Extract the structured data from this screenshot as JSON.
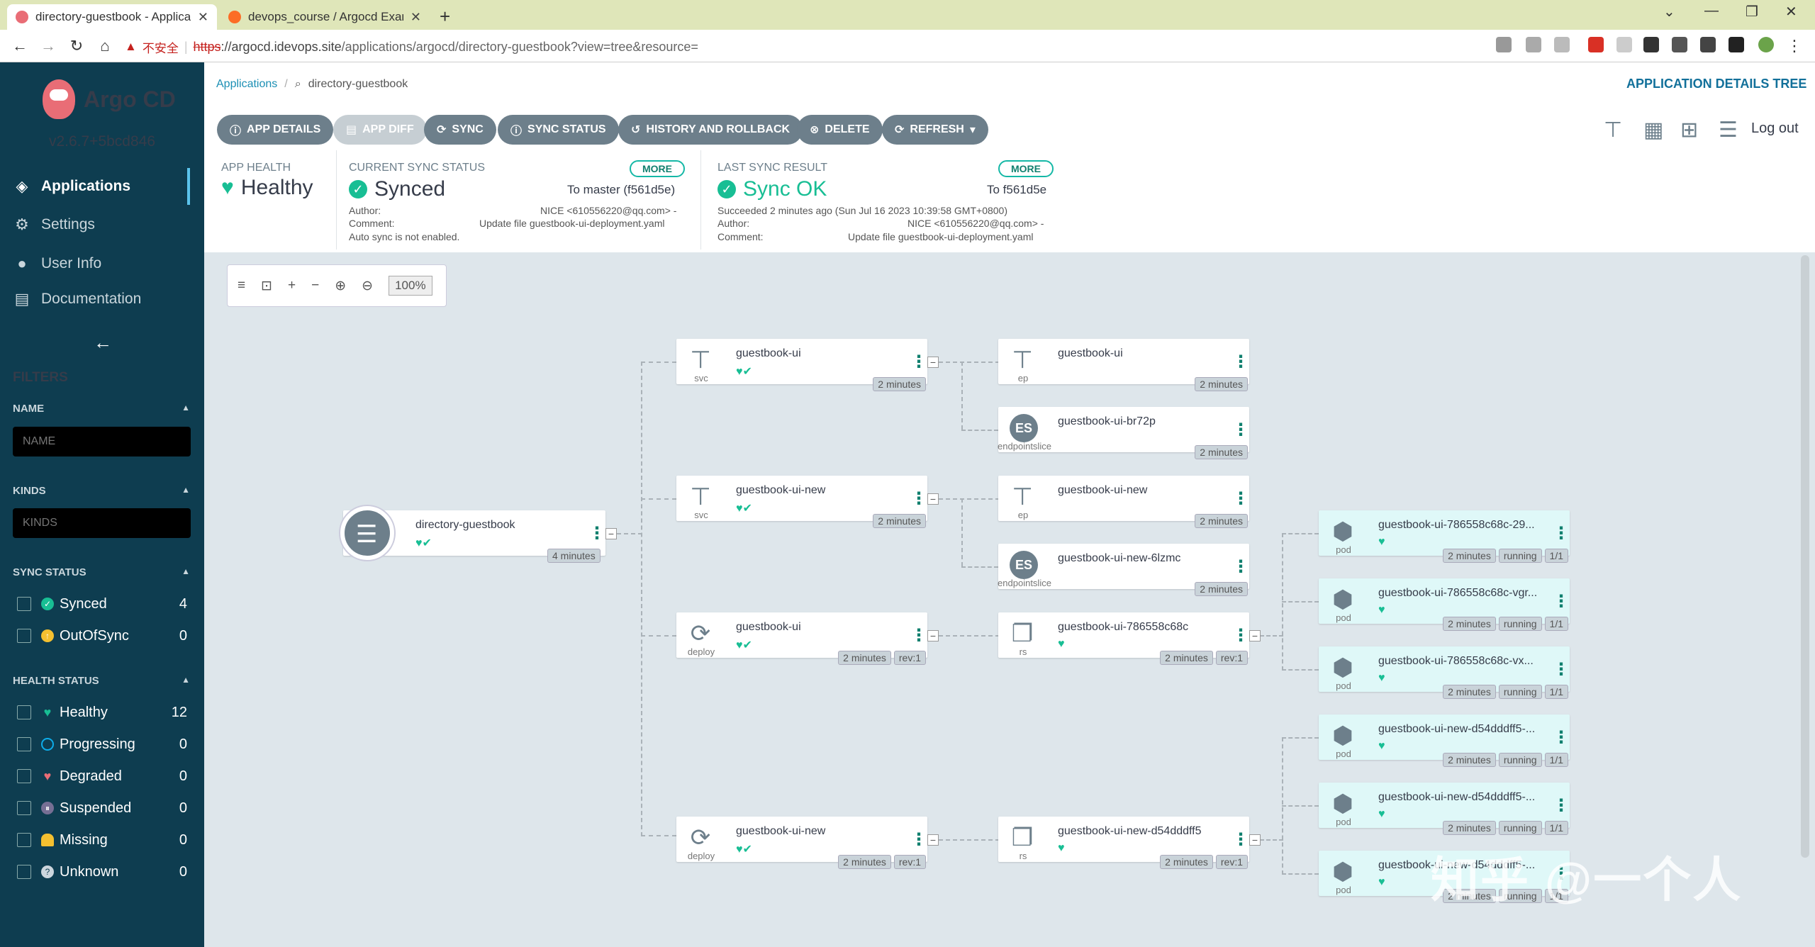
{
  "browser": {
    "tabs": [
      {
        "title": "directory-guestbook - Applica",
        "color": "#e96d76"
      },
      {
        "title": "devops_course / Argocd Exam",
        "color": "#fc6d26"
      }
    ],
    "url_warning": "不安全",
    "url_scheme": "https",
    "url_host": "://argocd.idevops.site",
    "url_path": "/applications/argocd/directory-guestbook?view=tree&resource="
  },
  "sidebar": {
    "app_name": "Argo CD",
    "version": "v2.6.7+5bcd846",
    "nav": [
      {
        "label": "Applications",
        "icon": "layers-icon"
      },
      {
        "label": "Settings",
        "icon": "gears-icon"
      },
      {
        "label": "User Info",
        "icon": "user-icon"
      },
      {
        "label": "Documentation",
        "icon": "book-icon"
      }
    ],
    "filters_title": "FILTERS",
    "name_label": "NAME",
    "name_placeholder": "NAME",
    "kinds_label": "KINDS",
    "kinds_placeholder": "KINDS",
    "sync_status_label": "SYNC STATUS",
    "sync_status": [
      {
        "label": "Synced",
        "count": "4",
        "color": "#18be94"
      },
      {
        "label": "OutOfSync",
        "count": "0",
        "color": "#f4c030"
      }
    ],
    "health_status_label": "HEALTH STATUS",
    "health_status": [
      {
        "label": "Healthy",
        "count": "12",
        "color": "#18be94"
      },
      {
        "label": "Progressing",
        "count": "0",
        "color": "#0dadea"
      },
      {
        "label": "Degraded",
        "count": "0",
        "color": "#e96d76"
      },
      {
        "label": "Suspended",
        "count": "0",
        "color": "#766f94"
      },
      {
        "label": "Missing",
        "count": "0",
        "color": "#f4c030"
      },
      {
        "label": "Unknown",
        "count": "0",
        "color": "#ccd6dd"
      }
    ]
  },
  "header": {
    "breadcrumb_root": "Applications",
    "breadcrumb_current": "directory-guestbook",
    "view_title": "APPLICATION DETAILS TREE",
    "buttons": [
      "APP DETAILS",
      "APP DIFF",
      "SYNC",
      "SYNC STATUS",
      "HISTORY AND ROLLBACK",
      "DELETE",
      "REFRESH"
    ],
    "logout": "Log out"
  },
  "status": {
    "app_health_label": "APP HEALTH",
    "app_health": "Healthy",
    "current_sync_label": "CURRENT SYNC STATUS",
    "current_sync": "Synced",
    "more": "MORE",
    "current_target": "To master (f561d5e)",
    "author_label": "Author:",
    "author": "NICE <610556220@qq.com> -",
    "comment_label": "Comment:",
    "comment": "Update file guestbook-ui-deployment.yaml",
    "auto_sync": "Auto sync is not enabled.",
    "last_sync_label": "LAST SYNC RESULT",
    "last_sync": "Sync OK",
    "last_target": "To f561d5e",
    "succeeded": "Succeeded 2 minutes ago (Sun Jul 16 2023 10:39:58 GMT+0800)"
  },
  "graph": {
    "zoom": "100%",
    "root": {
      "name": "directory-guestbook",
      "age": "4 minutes"
    },
    "nodes": {
      "svc1": {
        "name": "guestbook-ui",
        "kind": "svc",
        "age": "2 minutes"
      },
      "svc2": {
        "name": "guestbook-ui-new",
        "kind": "svc",
        "age": "2 minutes"
      },
      "dep1": {
        "name": "guestbook-ui",
        "kind": "deploy",
        "age": "2 minutes",
        "rev": "rev:1"
      },
      "dep2": {
        "name": "guestbook-ui-new",
        "kind": "deploy",
        "age": "2 minutes",
        "rev": "rev:1"
      },
      "ep1": {
        "name": "guestbook-ui",
        "kind": "ep",
        "age": "2 minutes"
      },
      "es1": {
        "name": "guestbook-ui-br72p",
        "kind": "endpointslice",
        "age": "2 minutes"
      },
      "ep2": {
        "name": "guestbook-ui-new",
        "kind": "ep",
        "age": "2 minutes"
      },
      "es2": {
        "name": "guestbook-ui-new-6lzmc",
        "kind": "endpointslice",
        "age": "2 minutes"
      },
      "rs1": {
        "name": "guestbook-ui-786558c68c",
        "kind": "rs",
        "age": "2 minutes",
        "rev": "rev:1"
      },
      "rs2": {
        "name": "guestbook-ui-new-d54dddff5",
        "kind": "rs",
        "age": "2 minutes",
        "rev": "rev:1"
      },
      "pod1": {
        "name": "guestbook-ui-786558c68c-29...",
        "kind": "pod",
        "age": "2 minutes",
        "state": "running",
        "ready": "1/1"
      },
      "pod2": {
        "name": "guestbook-ui-786558c68c-vgr...",
        "kind": "pod",
        "age": "2 minutes",
        "state": "running",
        "ready": "1/1"
      },
      "pod3": {
        "name": "guestbook-ui-786558c68c-vx...",
        "kind": "pod",
        "age": "2 minutes",
        "state": "running",
        "ready": "1/1"
      },
      "pod4": {
        "name": "guestbook-ui-new-d54dddff5-...",
        "kind": "pod",
        "age": "2 minutes",
        "state": "running",
        "ready": "1/1"
      },
      "pod5": {
        "name": "guestbook-ui-new-d54dddff5-...",
        "kind": "pod",
        "age": "2 minutes",
        "state": "running",
        "ready": "1/1"
      },
      "pod6": {
        "name": "guestbook-ui-new-d54dddff5-...",
        "kind": "pod",
        "age": "2 minutes",
        "state": "running",
        "ready": "1/1"
      }
    }
  },
  "watermark": "知乎 @一个人"
}
